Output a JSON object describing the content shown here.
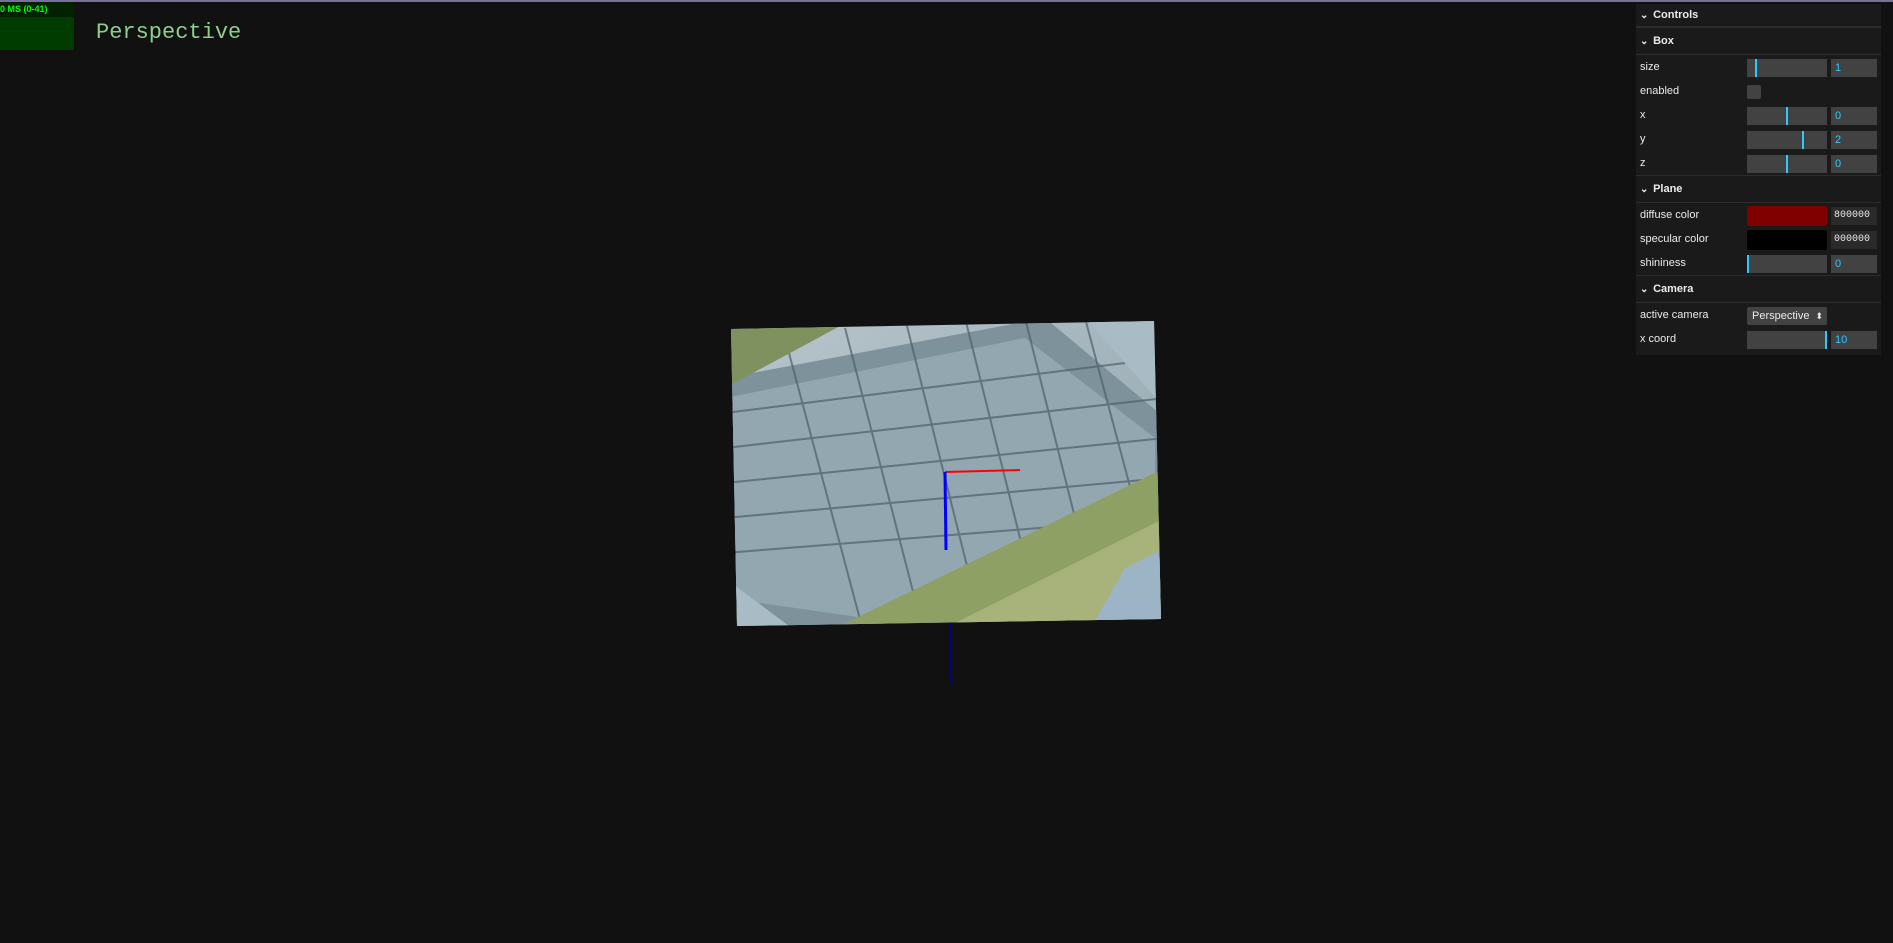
{
  "stats": {
    "text": "0 MS (0-41)"
  },
  "camera_label": "Perspective",
  "gui": {
    "title": "Controls",
    "folders": {
      "box": {
        "title": "Box",
        "size": {
          "label": "size",
          "value": "1",
          "fraction": 0.1
        },
        "enabled": {
          "label": "enabled",
          "checked": false
        },
        "x": {
          "label": "x",
          "value": "0",
          "fraction": 0.5
        },
        "y": {
          "label": "y",
          "value": "2",
          "fraction": 0.7
        },
        "z": {
          "label": "z",
          "value": "0",
          "fraction": 0.5
        }
      },
      "plane": {
        "title": "Plane",
        "diffuse": {
          "label": "diffuse color",
          "value": "800000",
          "color": "#800000"
        },
        "specular": {
          "label": "specular color",
          "value": "000000",
          "color": "#000000"
        },
        "shininess": {
          "label": "shininess",
          "value": "0",
          "fraction": 0.0
        }
      },
      "camera": {
        "title": "Camera",
        "active": {
          "label": "active camera",
          "value": "Perspective"
        },
        "xcoord": {
          "label": "x coord",
          "value": "10",
          "fraction": 1.0
        }
      }
    }
  },
  "colors": {
    "accent": "#2cc9ff",
    "axis_x": "#ff0000",
    "axis_y": "#0000ff"
  }
}
